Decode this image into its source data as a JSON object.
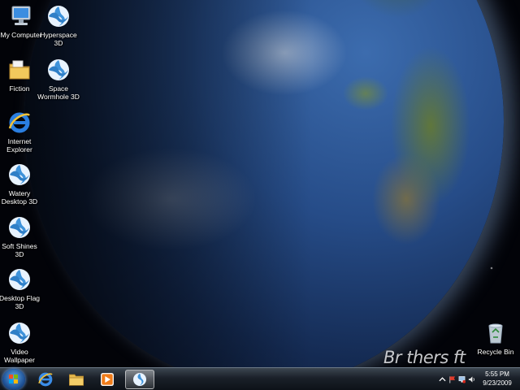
{
  "desktop": {
    "icons": [
      {
        "label": "My Computer",
        "icon": "computer-icon"
      },
      {
        "label": "Hyperspace\n3D",
        "icon": "screensaver-icon"
      },
      {
        "label": "Fiction",
        "icon": "folder-icon"
      },
      {
        "label": "Space\nWormhole 3D",
        "icon": "screensaver-icon"
      },
      {
        "label": "Internet\nExplorer",
        "icon": "internet-explorer-icon"
      },
      {
        "label": "Watery\nDesktop 3D",
        "icon": "screensaver-icon"
      },
      {
        "label": "Soft Shines\n3D",
        "icon": "screensaver-icon"
      },
      {
        "label": "Desktop Flag\n3D",
        "icon": "screensaver-icon"
      },
      {
        "label": "Video\nWallpaper",
        "icon": "screensaver-icon"
      },
      {
        "label": "Recycle Bin",
        "icon": "recycle-bin-icon"
      }
    ]
  },
  "watermark": {
    "text": "Br thers ft",
    "logo": "brothersoft-logo"
  },
  "taskbar": {
    "start_icon": "windows-start-icon",
    "pinned": [
      {
        "icon": "internet-explorer-icon"
      },
      {
        "icon": "folder-icon"
      },
      {
        "icon": "media-player-icon"
      },
      {
        "icon": "screensaver-app-icon",
        "active": true
      }
    ],
    "tray_icons": [
      "arrow-up-icon",
      "flag-icon",
      "network-icon",
      "volume-icon"
    ],
    "clock": {
      "time": "5:55 PM",
      "date": "9/23/2009"
    }
  },
  "colors": {
    "taskbar": "#1a2029",
    "accent": "#5fa7e8",
    "icon_blue": "#4aa0e0"
  }
}
